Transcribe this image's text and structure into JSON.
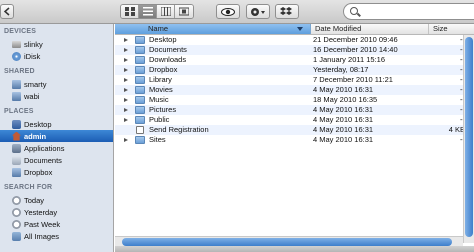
{
  "toolbar": {
    "back_icon": "chevron-left-icon",
    "view_modes": [
      "icon-view",
      "list-view",
      "column-view",
      "cover-flow-view"
    ],
    "active_view": "list-view",
    "quicklook_icon": "eye-icon",
    "action_icon": "gear-icon",
    "dropbox_icon": "dropbox-icon",
    "search_placeholder": ""
  },
  "sidebar": {
    "devices_label": "DEVICES",
    "devices": [
      {
        "label": "slinky",
        "icon": "hard-drive-icon"
      },
      {
        "label": "iDisk",
        "icon": "idisk-icon"
      }
    ],
    "shared_label": "SHARED",
    "shared": [
      {
        "label": "smarty",
        "icon": "network-computer-icon"
      },
      {
        "label": "wabi",
        "icon": "network-computer-icon"
      }
    ],
    "places_label": "PLACES",
    "places": [
      {
        "label": "Desktop",
        "icon": "desktop-icon"
      },
      {
        "label": "admin",
        "icon": "home-icon",
        "selected": true
      },
      {
        "label": "Applications",
        "icon": "applications-icon"
      },
      {
        "label": "Documents",
        "icon": "documents-icon"
      },
      {
        "label": "Dropbox",
        "icon": "dropbox-folder-icon"
      }
    ],
    "search_label": "SEARCH FOR",
    "search": [
      {
        "label": "Today",
        "icon": "clock-icon"
      },
      {
        "label": "Yesterday",
        "icon": "clock-icon"
      },
      {
        "label": "Past Week",
        "icon": "clock-icon"
      },
      {
        "label": "All Images",
        "icon": "images-icon"
      }
    ]
  },
  "table": {
    "columns": {
      "name": "Name",
      "date": "Date Modified",
      "size": "Size"
    },
    "rows": [
      {
        "name": "Desktop",
        "date": "21 December 2010 09:46",
        "size": "--",
        "type": "folder"
      },
      {
        "name": "Documents",
        "date": "16 December 2010 14:40",
        "size": "--",
        "type": "folder"
      },
      {
        "name": "Downloads",
        "date": "1 January 2011 15:16",
        "size": "--",
        "type": "folder"
      },
      {
        "name": "Dropbox",
        "date": "Yesterday, 08:17",
        "size": "--",
        "type": "folder"
      },
      {
        "name": "Library",
        "date": "7 December 2010 11:21",
        "size": "--",
        "type": "folder"
      },
      {
        "name": "Movies",
        "date": "4 May 2010 16:31",
        "size": "--",
        "type": "folder"
      },
      {
        "name": "Music",
        "date": "18 May 2010 16:35",
        "size": "--",
        "type": "folder"
      },
      {
        "name": "Pictures",
        "date": "4 May 2010 16:31",
        "size": "--",
        "type": "folder"
      },
      {
        "name": "Public",
        "date": "4 May 2010 16:31",
        "size": "--",
        "type": "folder"
      },
      {
        "name": "Send Registration",
        "date": "4 May 2010 16:31",
        "size": "4 KB",
        "type": "file"
      },
      {
        "name": "Sites",
        "date": "4 May 2010 16:31",
        "size": "--",
        "type": "folder"
      }
    ]
  }
}
